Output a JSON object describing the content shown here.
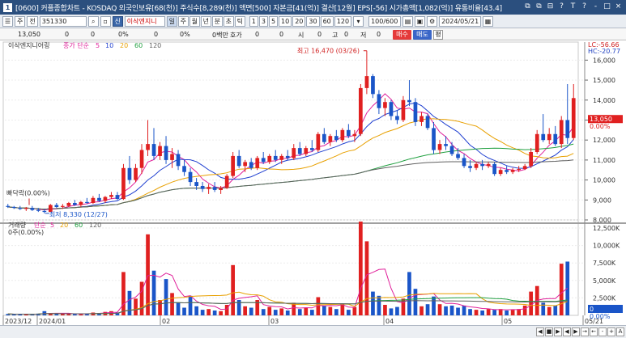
{
  "window": {
    "title": "[0600] 커플종합차트 - KOSDAQ 외국인보유[68(천)] 주식수[8,289(천)] 액면[500] 자본금[41(억)] 결산[12월] EPS[-56] 시가총액[1,082(억)] 유통비율[43.4]",
    "app_icon": "1",
    "window_buttons": [
      "⧉",
      "⧉",
      "⊟",
      "?",
      "T",
      "?",
      "-",
      "□",
      "×"
    ]
  },
  "toolbar": {
    "menu_btn": "☰",
    "mode_label": "주",
    "prev_label": "전",
    "code_value": "351330",
    "stock_name": "이삭엔지니",
    "period_buttons": [
      "일",
      "주",
      "월",
      "년",
      "분",
      "초",
      "틱"
    ],
    "selected_period": "일",
    "interval_buttons": [
      "1",
      "3",
      "5",
      "10",
      "20",
      "30",
      "60",
      "120"
    ],
    "count_value": "100/600",
    "date_value": "2024/05/21"
  },
  "quote": {
    "price": "13,050",
    "fields": [
      "0",
      "0",
      "0%",
      "0",
      "0%",
      "0백만",
      "호가",
      "0",
      "0",
      "시",
      "0",
      "고",
      "0",
      "저",
      "0"
    ],
    "buy": "매수",
    "sell": "매도",
    "flat": "평"
  },
  "price_panel": {
    "series_name": "이삭엔지니어링",
    "ma_label": "종가 단순",
    "ma_periods": [
      "5",
      "10",
      "20",
      "60",
      "120"
    ],
    "ma_colors": [
      "#e0209a",
      "#2040d0",
      "#e8a000",
      "#20a040",
      "#606060"
    ],
    "lc_label": "LC:-56.66",
    "hc_label": "HC:-20.77",
    "current_price": "13,050",
    "current_pct": "0.00%",
    "high_annotation": "최고 16,470 (03/26)",
    "low_annotation": "최저 8,330 (12/27)",
    "base_annotation": "빠닥락(0.00%)",
    "y_ticks": [
      "16,000",
      "15,000",
      "14,000",
      "13,000",
      "12,000",
      "11,000",
      "10,000",
      "9,000",
      "8,000"
    ]
  },
  "volume_panel": {
    "series_name": "거래량",
    "ma_label": "단순",
    "ma_periods": [
      "5",
      "20",
      "60",
      "120"
    ],
    "summary": "0주(0.00%)",
    "current_value": "0",
    "current_pct": "0.00%",
    "y_ticks": [
      "12,500K",
      "10,000K",
      "7,500K",
      "5,000K",
      "2,500K"
    ]
  },
  "x_axis": {
    "labels": [
      "2023/12",
      "2024/01",
      "02",
      "03",
      "04",
      "05",
      "05/21"
    ]
  },
  "nav": {
    "buttons": [
      "◀",
      "■",
      "▶",
      "◀",
      "▶",
      "→",
      "←",
      "-",
      "+",
      "A"
    ]
  },
  "chart_data": {
    "type": "candlestick",
    "price_min": 8000,
    "price_max": 16500,
    "candles": [
      {
        "o": 8700,
        "h": 8800,
        "l": 8600,
        "c": 8650
      },
      {
        "o": 8650,
        "h": 8700,
        "l": 8550,
        "c": 8600
      },
      {
        "o": 8600,
        "h": 8700,
        "l": 8500,
        "c": 8550
      },
      {
        "o": 8550,
        "h": 8650,
        "l": 8450,
        "c": 8600
      },
      {
        "o": 8600,
        "h": 8700,
        "l": 8450,
        "c": 8500
      },
      {
        "o": 8500,
        "h": 8600,
        "l": 8400,
        "c": 8450
      },
      {
        "o": 8450,
        "h": 8550,
        "l": 8330,
        "c": 8400
      },
      {
        "o": 8400,
        "h": 8800,
        "l": 8380,
        "c": 8750
      },
      {
        "o": 8750,
        "h": 8850,
        "l": 8600,
        "c": 8650
      },
      {
        "o": 8650,
        "h": 8800,
        "l": 8550,
        "c": 8700
      },
      {
        "o": 8700,
        "h": 8900,
        "l": 8650,
        "c": 8850
      },
      {
        "o": 8850,
        "h": 9000,
        "l": 8700,
        "c": 8750
      },
      {
        "o": 8750,
        "h": 8950,
        "l": 8650,
        "c": 8900
      },
      {
        "o": 8900,
        "h": 9100,
        "l": 8800,
        "c": 8850
      },
      {
        "o": 8850,
        "h": 9200,
        "l": 8800,
        "c": 9100
      },
      {
        "o": 9100,
        "h": 9300,
        "l": 8900,
        "c": 8950
      },
      {
        "o": 8950,
        "h": 9200,
        "l": 8850,
        "c": 9150
      },
      {
        "o": 9150,
        "h": 9400,
        "l": 9050,
        "c": 9250
      },
      {
        "o": 9250,
        "h": 9400,
        "l": 9000,
        "c": 9050
      },
      {
        "o": 9050,
        "h": 10800,
        "l": 9000,
        "c": 10600
      },
      {
        "o": 10600,
        "h": 11200,
        "l": 9800,
        "c": 10000
      },
      {
        "o": 10000,
        "h": 10800,
        "l": 9900,
        "c": 10600
      },
      {
        "o": 10600,
        "h": 11800,
        "l": 10300,
        "c": 11500
      },
      {
        "o": 11500,
        "h": 13000,
        "l": 11200,
        "c": 11800
      },
      {
        "o": 11800,
        "h": 12600,
        "l": 11000,
        "c": 11200
      },
      {
        "o": 11200,
        "h": 11900,
        "l": 11000,
        "c": 11700
      },
      {
        "o": 11700,
        "h": 12200,
        "l": 10800,
        "c": 11000
      },
      {
        "o": 11000,
        "h": 11600,
        "l": 10600,
        "c": 11300
      },
      {
        "o": 11300,
        "h": 11500,
        "l": 10500,
        "c": 10700
      },
      {
        "o": 10700,
        "h": 11000,
        "l": 10200,
        "c": 10400
      },
      {
        "o": 10400,
        "h": 10600,
        "l": 9700,
        "c": 9900
      },
      {
        "o": 9900,
        "h": 10100,
        "l": 9500,
        "c": 9700
      },
      {
        "o": 9700,
        "h": 9900,
        "l": 9400,
        "c": 9550
      },
      {
        "o": 9550,
        "h": 9800,
        "l": 9300,
        "c": 9650
      },
      {
        "o": 9650,
        "h": 9900,
        "l": 9400,
        "c": 9500
      },
      {
        "o": 9500,
        "h": 9700,
        "l": 9300,
        "c": 9600
      },
      {
        "o": 9600,
        "h": 10300,
        "l": 9550,
        "c": 10200
      },
      {
        "o": 10200,
        "h": 11400,
        "l": 10100,
        "c": 11200
      },
      {
        "o": 11200,
        "h": 11500,
        "l": 10600,
        "c": 10700
      },
      {
        "o": 10700,
        "h": 11000,
        "l": 10400,
        "c": 10900
      },
      {
        "o": 10900,
        "h": 11100,
        "l": 10500,
        "c": 10600
      },
      {
        "o": 10600,
        "h": 11200,
        "l": 10500,
        "c": 11100
      },
      {
        "o": 11100,
        "h": 11400,
        "l": 10800,
        "c": 10900
      },
      {
        "o": 10900,
        "h": 11300,
        "l": 10800,
        "c": 11200
      },
      {
        "o": 11200,
        "h": 11500,
        "l": 10900,
        "c": 11000
      },
      {
        "o": 11000,
        "h": 11300,
        "l": 10800,
        "c": 11200
      },
      {
        "o": 11200,
        "h": 11500,
        "l": 11000,
        "c": 11100
      },
      {
        "o": 11100,
        "h": 11800,
        "l": 11000,
        "c": 11600
      },
      {
        "o": 11600,
        "h": 11900,
        "l": 11200,
        "c": 11300
      },
      {
        "o": 11300,
        "h": 11700,
        "l": 11200,
        "c": 11600
      },
      {
        "o": 11600,
        "h": 12000,
        "l": 11400,
        "c": 11500
      },
      {
        "o": 11500,
        "h": 12400,
        "l": 11400,
        "c": 12300
      },
      {
        "o": 12300,
        "h": 12600,
        "l": 11800,
        "c": 11900
      },
      {
        "o": 11900,
        "h": 12300,
        "l": 11700,
        "c": 12200
      },
      {
        "o": 12200,
        "h": 12500,
        "l": 11900,
        "c": 12000
      },
      {
        "o": 12000,
        "h": 12600,
        "l": 11900,
        "c": 12500
      },
      {
        "o": 12500,
        "h": 12800,
        "l": 12100,
        "c": 12200
      },
      {
        "o": 12200,
        "h": 12500,
        "l": 11900,
        "c": 12300
      },
      {
        "o": 12300,
        "h": 14800,
        "l": 12200,
        "c": 14600
      },
      {
        "o": 14600,
        "h": 16470,
        "l": 14300,
        "c": 15200
      },
      {
        "o": 15200,
        "h": 15300,
        "l": 14100,
        "c": 14300
      },
      {
        "o": 14300,
        "h": 14500,
        "l": 13300,
        "c": 13600
      },
      {
        "o": 13600,
        "h": 14100,
        "l": 13200,
        "c": 13900
      },
      {
        "o": 13900,
        "h": 14000,
        "l": 13000,
        "c": 13200
      },
      {
        "o": 13200,
        "h": 13500,
        "l": 12800,
        "c": 13000
      },
      {
        "o": 13000,
        "h": 14200,
        "l": 12900,
        "c": 14000
      },
      {
        "o": 14000,
        "h": 15000,
        "l": 13700,
        "c": 13900
      },
      {
        "o": 13900,
        "h": 14100,
        "l": 12700,
        "c": 12900
      },
      {
        "o": 12900,
        "h": 13400,
        "l": 12700,
        "c": 13200
      },
      {
        "o": 13200,
        "h": 13300,
        "l": 12500,
        "c": 12600
      },
      {
        "o": 12600,
        "h": 12900,
        "l": 11300,
        "c": 11500
      },
      {
        "o": 11500,
        "h": 12000,
        "l": 11300,
        "c": 11800
      },
      {
        "o": 11800,
        "h": 12200,
        "l": 11500,
        "c": 11700
      },
      {
        "o": 11700,
        "h": 11900,
        "l": 11200,
        "c": 11300
      },
      {
        "o": 11300,
        "h": 11600,
        "l": 11000,
        "c": 11100
      },
      {
        "o": 11100,
        "h": 11300,
        "l": 10600,
        "c": 10700
      },
      {
        "o": 10700,
        "h": 11000,
        "l": 10400,
        "c": 10600
      },
      {
        "o": 10600,
        "h": 10900,
        "l": 10500,
        "c": 10800
      },
      {
        "o": 10800,
        "h": 11000,
        "l": 10500,
        "c": 10700
      },
      {
        "o": 10700,
        "h": 10900,
        "l": 10600,
        "c": 10800
      },
      {
        "o": 10800,
        "h": 10900,
        "l": 10200,
        "c": 10300
      },
      {
        "o": 10300,
        "h": 10600,
        "l": 10200,
        "c": 10500
      },
      {
        "o": 10500,
        "h": 10700,
        "l": 10300,
        "c": 10400
      },
      {
        "o": 10400,
        "h": 10600,
        "l": 10300,
        "c": 10500
      },
      {
        "o": 10500,
        "h": 10700,
        "l": 10400,
        "c": 10550
      },
      {
        "o": 10550,
        "h": 10800,
        "l": 10500,
        "c": 10700
      },
      {
        "o": 10700,
        "h": 11600,
        "l": 10600,
        "c": 11400
      },
      {
        "o": 11400,
        "h": 12500,
        "l": 11300,
        "c": 12300
      },
      {
        "o": 12300,
        "h": 13300,
        "l": 11900,
        "c": 12000
      },
      {
        "o": 12000,
        "h": 12600,
        "l": 11800,
        "c": 12300
      },
      {
        "o": 12300,
        "h": 12700,
        "l": 11700,
        "c": 11800
      },
      {
        "o": 11800,
        "h": 13200,
        "l": 11600,
        "c": 13000
      },
      {
        "o": 13000,
        "h": 14800,
        "l": 11800,
        "c": 12100
      },
      {
        "o": 12100,
        "h": 14800,
        "l": 12000,
        "c": 14100
      }
    ],
    "volumes_k": [
      200,
      150,
      180,
      160,
      140,
      250,
      600,
      300,
      200,
      180,
      220,
      190,
      260,
      230,
      400,
      350,
      500,
      600,
      400,
      6200,
      3500,
      2400,
      4800,
      11600,
      6400,
      2200,
      5200,
      3200,
      1800,
      1100,
      2800,
      1300,
      800,
      900,
      700,
      600,
      1500,
      7200,
      2200,
      1300,
      1100,
      2200,
      900,
      1200,
      800,
      1000,
      700,
      1800,
      900,
      1100,
      800,
      2600,
      1400,
      1200,
      900,
      1600,
      800,
      1200,
      14800,
      10600,
      3400,
      2800,
      1500,
      1000,
      1200,
      2400,
      6200,
      3800,
      1300,
      1600,
      2700,
      1600,
      1300,
      1400,
      1100,
      1400,
      900,
      800,
      700,
      900,
      800,
      900,
      700,
      800,
      900,
      1400,
      3400,
      4200,
      1800,
      1200,
      1400,
      7400,
      7700
    ],
    "vol_max_k": 12500
  }
}
